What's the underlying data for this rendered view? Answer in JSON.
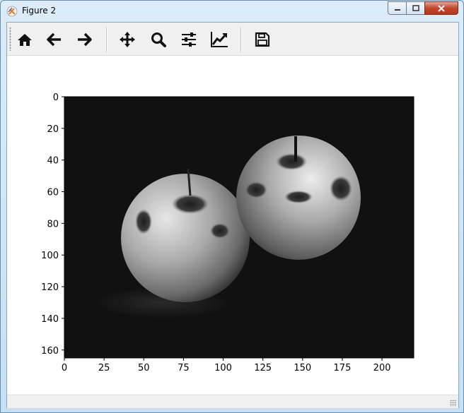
{
  "window": {
    "title": "Figure 2"
  },
  "toolbar": {
    "items": [
      {
        "name": "home-icon",
        "label": "Home"
      },
      {
        "name": "back-icon",
        "label": "Back"
      },
      {
        "name": "forward-icon",
        "label": "Forward"
      },
      {
        "name": "pan-icon",
        "label": "Pan"
      },
      {
        "name": "zoom-icon",
        "label": "Zoom"
      },
      {
        "name": "subplots-icon",
        "label": "Configure subplots"
      },
      {
        "name": "edit-axis-icon",
        "label": "Edit axis"
      },
      {
        "name": "save-icon",
        "label": "Save"
      }
    ]
  },
  "chart_data": {
    "type": "image",
    "xlim": [
      0,
      220
    ],
    "ylim": [
      165,
      0
    ],
    "xticks": [
      0,
      25,
      50,
      75,
      100,
      125,
      150,
      175,
      200
    ],
    "yticks": [
      0,
      20,
      40,
      60,
      80,
      100,
      120,
      140,
      160
    ],
    "colormap": "gray"
  },
  "colors": {
    "background": "#111111",
    "titlebar": "#cfe6f5",
    "close_button": "#c4452a"
  }
}
